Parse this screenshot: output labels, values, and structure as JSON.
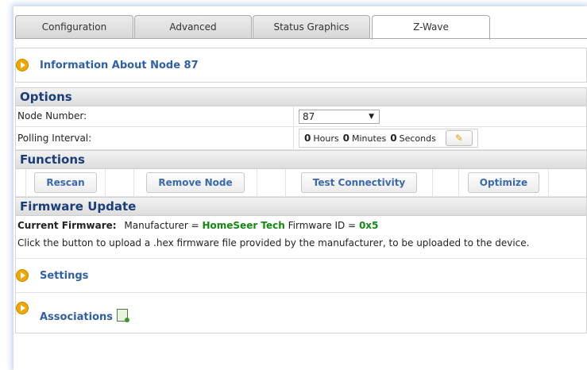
{
  "tabs": [
    {
      "label": "Configuration"
    },
    {
      "label": "Advanced"
    },
    {
      "label": "Status Graphics"
    },
    {
      "label": "Z-Wave"
    }
  ],
  "info": {
    "label": "Information About Node 87"
  },
  "options": {
    "header": "Options",
    "node_number_label": "Node Number:",
    "node_number_value": "87",
    "polling_label": "Polling Interval:",
    "polling": {
      "hours": "0",
      "hours_unit": "Hours",
      "minutes": "0",
      "minutes_unit": "Minutes",
      "seconds": "0",
      "seconds_unit": "Seconds"
    }
  },
  "functions": {
    "header": "Functions",
    "buttons": [
      "Rescan",
      "Remove Node",
      "Test Connectivity",
      "Optimize"
    ]
  },
  "firmware": {
    "header": "Firmware Update",
    "current_label": "Current Firmware:",
    "manufacturer_prefix": "Manufacturer =",
    "manufacturer": "HomeSeer Tech",
    "id_prefix": "Firmware ID =",
    "id": "0x5",
    "instructions": "Click the button to upload a .hex firmware file provided by the manufacturer, to be uploaded to the device."
  },
  "settings": {
    "label": "Settings"
  },
  "associations": {
    "label": "Associations"
  }
}
